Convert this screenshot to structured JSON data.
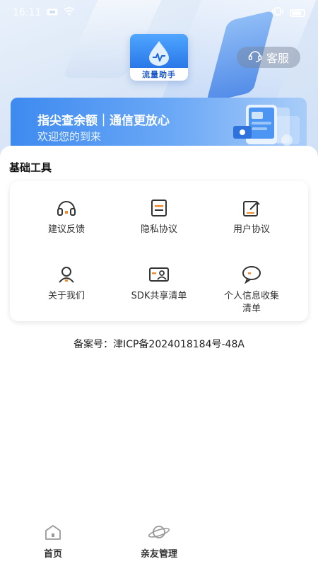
{
  "status_bar": {
    "time": "16:11",
    "icons": [
      "hd-icon",
      "wifi-icon",
      "vibrate-icon",
      "battery-icon"
    ]
  },
  "header": {
    "app_name": "流量助手",
    "service_label": "客服"
  },
  "banner": {
    "title": "指尖查余额｜通信更放心",
    "subtitle": "欢迎您的到来"
  },
  "tools": {
    "section_title": "基础工具",
    "items": [
      {
        "label": "建议反馈",
        "icon": "headset-icon"
      },
      {
        "label": "隐私协议",
        "icon": "document-icon"
      },
      {
        "label": "用户协议",
        "icon": "edit-document-icon"
      },
      {
        "label": "关于我们",
        "icon": "user-icon"
      },
      {
        "label": "SDK共享清单",
        "icon": "id-card-icon"
      },
      {
        "label_line1": "个人信息收集",
        "label_line2": "清单",
        "icon": "chat-bubble-icon"
      }
    ]
  },
  "record": {
    "text": "备案号：津ICP备2024018184号-48A"
  },
  "tabbar": {
    "tabs": [
      {
        "label": "首页",
        "icon": "home-icon"
      },
      {
        "label": "亲友管理",
        "icon": "planet-icon"
      }
    ]
  },
  "colors": {
    "accent": "#1c66e0",
    "banner_start": "#3d8af0",
    "text_primary": "#222222"
  }
}
